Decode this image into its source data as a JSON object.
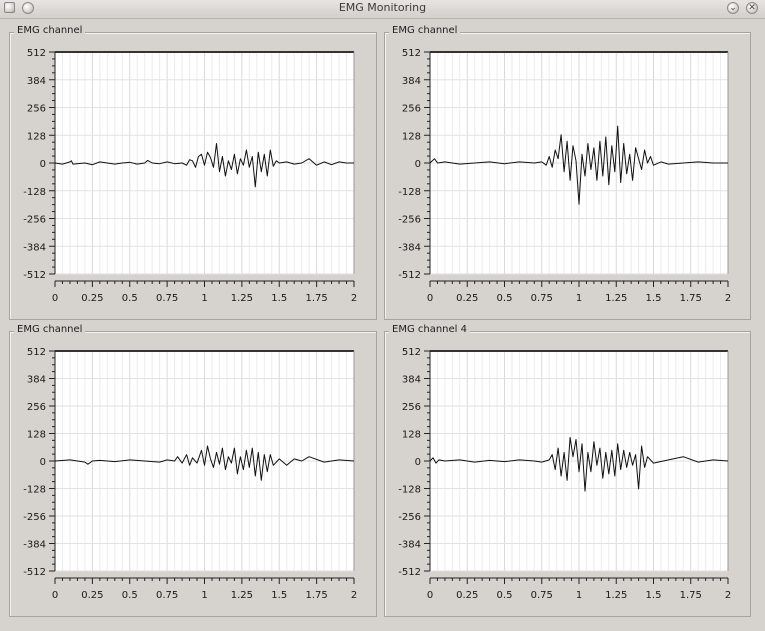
{
  "window": {
    "title": "EMG Monitoring",
    "minimize_glyph": "⌄",
    "close_glyph": "✕"
  },
  "panels": [
    {
      "title": "EMG channel"
    },
    {
      "title": "EMG channel"
    },
    {
      "title": "EMG channel"
    },
    {
      "title": "EMG channel 4"
    }
  ],
  "chart_data": [
    {
      "type": "line",
      "title": "EMG channel",
      "xlim": [
        0,
        2
      ],
      "ylim": [
        -512,
        512
      ],
      "x_ticks": [
        "0",
        "0.25",
        "0.5",
        "0.75",
        "1",
        "1.25",
        "1.5",
        "1.75",
        "2"
      ],
      "y_ticks": [
        "512",
        "384",
        "256",
        "128",
        "0",
        "-128",
        "-256",
        "-384",
        "-512"
      ],
      "grid": true,
      "series": [
        {
          "x": [
            0,
            0.05,
            0.1,
            0.11,
            0.12,
            0.2,
            0.25,
            0.3,
            0.35,
            0.4,
            0.45,
            0.5,
            0.55,
            0.6,
            0.62,
            0.65,
            0.7,
            0.75,
            0.8,
            0.85,
            0.88,
            0.9,
            0.92,
            0.94,
            0.96,
            0.98,
            1.0,
            1.02,
            1.04,
            1.06,
            1.08,
            1.1,
            1.12,
            1.14,
            1.16,
            1.18,
            1.2,
            1.22,
            1.24,
            1.26,
            1.28,
            1.3,
            1.32,
            1.34,
            1.36,
            1.38,
            1.4,
            1.42,
            1.44,
            1.46,
            1.48,
            1.5,
            1.55,
            1.6,
            1.65,
            1.7,
            1.75,
            1.8,
            1.85,
            1.9,
            1.95,
            2.0
          ],
          "y": [
            0,
            -5,
            5,
            10,
            -5,
            0,
            -8,
            5,
            0,
            -5,
            0,
            3,
            -5,
            0,
            12,
            0,
            -3,
            5,
            -3,
            0,
            -10,
            15,
            10,
            -20,
            30,
            40,
            -10,
            50,
            25,
            -20,
            90,
            -40,
            30,
            -60,
            10,
            -30,
            40,
            -50,
            20,
            -10,
            60,
            -20,
            30,
            -110,
            50,
            -40,
            40,
            -60,
            60,
            -15,
            10,
            0,
            5,
            -5,
            0,
            20,
            -10,
            5,
            -8,
            5,
            0,
            0
          ]
        }
      ]
    },
    {
      "type": "line",
      "title": "EMG channel",
      "xlim": [
        0,
        2
      ],
      "ylim": [
        -512,
        512
      ],
      "x_ticks": [
        "0",
        "0.25",
        "0.5",
        "0.75",
        "1",
        "1.25",
        "1.5",
        "1.75",
        "2"
      ],
      "y_ticks": [
        "512",
        "384",
        "256",
        "128",
        "0",
        "-128",
        "-256",
        "-384",
        "-512"
      ],
      "grid": true,
      "series": [
        {
          "x": [
            0,
            0.03,
            0.05,
            0.1,
            0.2,
            0.3,
            0.4,
            0.5,
            0.6,
            0.7,
            0.75,
            0.78,
            0.8,
            0.82,
            0.84,
            0.86,
            0.88,
            0.9,
            0.92,
            0.94,
            0.96,
            0.98,
            1.0,
            1.02,
            1.04,
            1.06,
            1.08,
            1.1,
            1.12,
            1.14,
            1.16,
            1.18,
            1.2,
            1.22,
            1.24,
            1.26,
            1.28,
            1.3,
            1.32,
            1.34,
            1.36,
            1.38,
            1.4,
            1.42,
            1.44,
            1.46,
            1.48,
            1.5,
            1.55,
            1.6,
            1.7,
            1.8,
            1.9,
            2.0
          ],
          "y": [
            0,
            20,
            0,
            5,
            -5,
            0,
            5,
            -3,
            5,
            0,
            5,
            -10,
            30,
            -20,
            60,
            20,
            130,
            -40,
            100,
            -80,
            80,
            10,
            -190,
            40,
            -60,
            90,
            -30,
            70,
            -80,
            100,
            -60,
            120,
            -100,
            80,
            -40,
            170,
            -90,
            90,
            -50,
            40,
            -80,
            70,
            20,
            -30,
            60,
            0,
            30,
            -10,
            5,
            -5,
            0,
            5,
            0,
            0
          ]
        }
      ]
    },
    {
      "type": "line",
      "title": "EMG channel",
      "xlim": [
        0,
        2
      ],
      "ylim": [
        -512,
        512
      ],
      "x_ticks": [
        "0",
        "0.25",
        "0.5",
        "0.75",
        "1",
        "1.25",
        "1.5",
        "1.75",
        "2"
      ],
      "y_ticks": [
        "512",
        "384",
        "256",
        "128",
        "0",
        "-128",
        "-256",
        "-384",
        "-512"
      ],
      "grid": true,
      "series": [
        {
          "x": [
            0,
            0.1,
            0.2,
            0.22,
            0.25,
            0.3,
            0.4,
            0.5,
            0.6,
            0.7,
            0.75,
            0.8,
            0.82,
            0.85,
            0.88,
            0.9,
            0.92,
            0.95,
            0.98,
            1.0,
            1.02,
            1.04,
            1.06,
            1.08,
            1.1,
            1.12,
            1.14,
            1.16,
            1.18,
            1.2,
            1.22,
            1.24,
            1.26,
            1.28,
            1.3,
            1.32,
            1.34,
            1.36,
            1.38,
            1.4,
            1.42,
            1.44,
            1.46,
            1.5,
            1.55,
            1.6,
            1.65,
            1.7,
            1.8,
            1.9,
            2.0
          ],
          "y": [
            0,
            5,
            -5,
            -15,
            0,
            3,
            -3,
            5,
            0,
            -5,
            5,
            0,
            20,
            -10,
            30,
            -20,
            15,
            -10,
            50,
            -20,
            70,
            10,
            -30,
            40,
            -15,
            60,
            -40,
            20,
            -10,
            60,
            -60,
            20,
            -40,
            50,
            -30,
            60,
            -70,
            40,
            -90,
            30,
            -50,
            30,
            -20,
            10,
            -20,
            10,
            0,
            20,
            -5,
            5,
            0
          ]
        }
      ]
    },
    {
      "type": "line",
      "title": "EMG channel 4",
      "xlim": [
        0,
        2
      ],
      "ylim": [
        -512,
        512
      ],
      "x_ticks": [
        "0",
        "0.25",
        "0.5",
        "0.75",
        "1",
        "1.25",
        "1.5",
        "1.75",
        "2"
      ],
      "y_ticks": [
        "512",
        "384",
        "256",
        "128",
        "0",
        "-128",
        "-256",
        "-384",
        "-512"
      ],
      "grid": true,
      "series": [
        {
          "x": [
            0,
            0.02,
            0.04,
            0.06,
            0.1,
            0.2,
            0.3,
            0.4,
            0.5,
            0.6,
            0.7,
            0.75,
            0.8,
            0.82,
            0.84,
            0.86,
            0.88,
            0.9,
            0.92,
            0.94,
            0.96,
            0.98,
            1.0,
            1.02,
            1.04,
            1.06,
            1.08,
            1.1,
            1.12,
            1.14,
            1.16,
            1.18,
            1.2,
            1.22,
            1.24,
            1.26,
            1.28,
            1.3,
            1.32,
            1.34,
            1.36,
            1.38,
            1.4,
            1.42,
            1.44,
            1.46,
            1.5,
            1.6,
            1.7,
            1.8,
            1.9,
            2.0
          ],
          "y": [
            0,
            15,
            -10,
            5,
            0,
            5,
            -5,
            3,
            -3,
            5,
            0,
            -5,
            5,
            30,
            -40,
            60,
            -70,
            40,
            -90,
            110,
            20,
            100,
            -50,
            80,
            -140,
            40,
            -50,
            90,
            -20,
            60,
            -80,
            40,
            -60,
            50,
            -70,
            80,
            -40,
            50,
            -30,
            40,
            -20,
            30,
            -130,
            70,
            -30,
            20,
            -10,
            5,
            20,
            -5,
            5,
            0
          ]
        }
      ]
    }
  ]
}
